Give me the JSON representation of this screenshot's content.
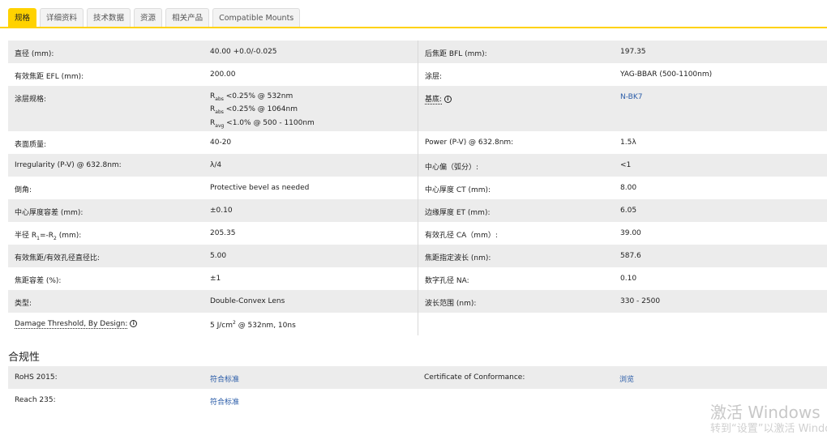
{
  "tabs": [
    "规格",
    "详细资料",
    "技术数据",
    "资源",
    "相关产品",
    "Compatible Mounts"
  ],
  "specs": [
    {
      "l1": "直径 (mm):",
      "v1": "40.00 +0.0/-0.025",
      "l2": "后焦距 BFL (mm):",
      "v2": "197.35"
    },
    {
      "l1": "有效焦距 EFL (mm):",
      "v1": "200.00",
      "l2": "涂层:",
      "v2": "YAG-BBAR (500-1100nm)"
    },
    {
      "l1": "涂层规格:",
      "coating": [
        {
          "sym": "R",
          "sub": "abs",
          "text": " <0.25% @ 532nm"
        },
        {
          "sym": "R",
          "sub": "abs",
          "text": " <0.25% @ 1064nm"
        },
        {
          "sym": "R",
          "sub": "avg",
          "text": " <1.0% @ 500 - 1100nm"
        }
      ],
      "l2": "基底:",
      "v2": "N-BK7"
    },
    {
      "l1": "表面质量:",
      "v1": "40-20",
      "l2": "Power (P-V) @ 632.8nm:",
      "v2": "1.5λ"
    },
    {
      "l1": "Irregularity (P-V) @ 632.8nm:",
      "v1": "λ/4",
      "l2": "中心偏（弧分）:",
      "v2": "<1"
    },
    {
      "l1": "倒角:",
      "v1": "Protective bevel as needed",
      "l2": "中心厚度 CT (mm):",
      "v2": "8.00"
    },
    {
      "l1": "中心厚度容差 (mm):",
      "v1": "±0.10",
      "l2": "边缘厚度 ET (mm):",
      "v2": "6.05"
    },
    {
      "l1a": "半径 R",
      "l1s1": "1",
      "l1b": "=-R",
      "l1s2": "2",
      "l1c": " (mm):",
      "v1": "205.35",
      "l2": "有效孔径 CA（mm）:",
      "v2": "39.00"
    },
    {
      "l1": "有效焦距/有效孔径直径比:",
      "v1": "5.00",
      "l2": "焦距指定波长 (nm):",
      "v2": "587.6"
    },
    {
      "l1": "焦距容差 (%):",
      "v1": "±1",
      "l2": "数字孔径 NA:",
      "v2": "0.10"
    },
    {
      "l1": "类型:",
      "v1": "Double-Convex Lens",
      "l2": "波长范围 (nm):",
      "v2": "330 - 2500"
    },
    {
      "l1": "Damage Threshold, By Design:",
      "v1a": "5 J/cm",
      "v1sup": "2",
      "v1b": " @ 532nm, 10ns"
    }
  ],
  "info_icon": "i",
  "compliance": {
    "title": "合规性",
    "rows": [
      {
        "l1": "RoHS 2015:",
        "v1": "符合标准",
        "l2": "Certificate of Conformance:",
        "v2": "浏览"
      },
      {
        "l1": "Reach 235:",
        "v1": "符合标准"
      }
    ]
  },
  "watermark": {
    "line1": "激活 Windows",
    "line2": "转到“设置”以激活 Windows。"
  },
  "colors": {
    "accent": "#ffd200",
    "link": "#2a5ca8",
    "row_alt": "#ececec"
  }
}
